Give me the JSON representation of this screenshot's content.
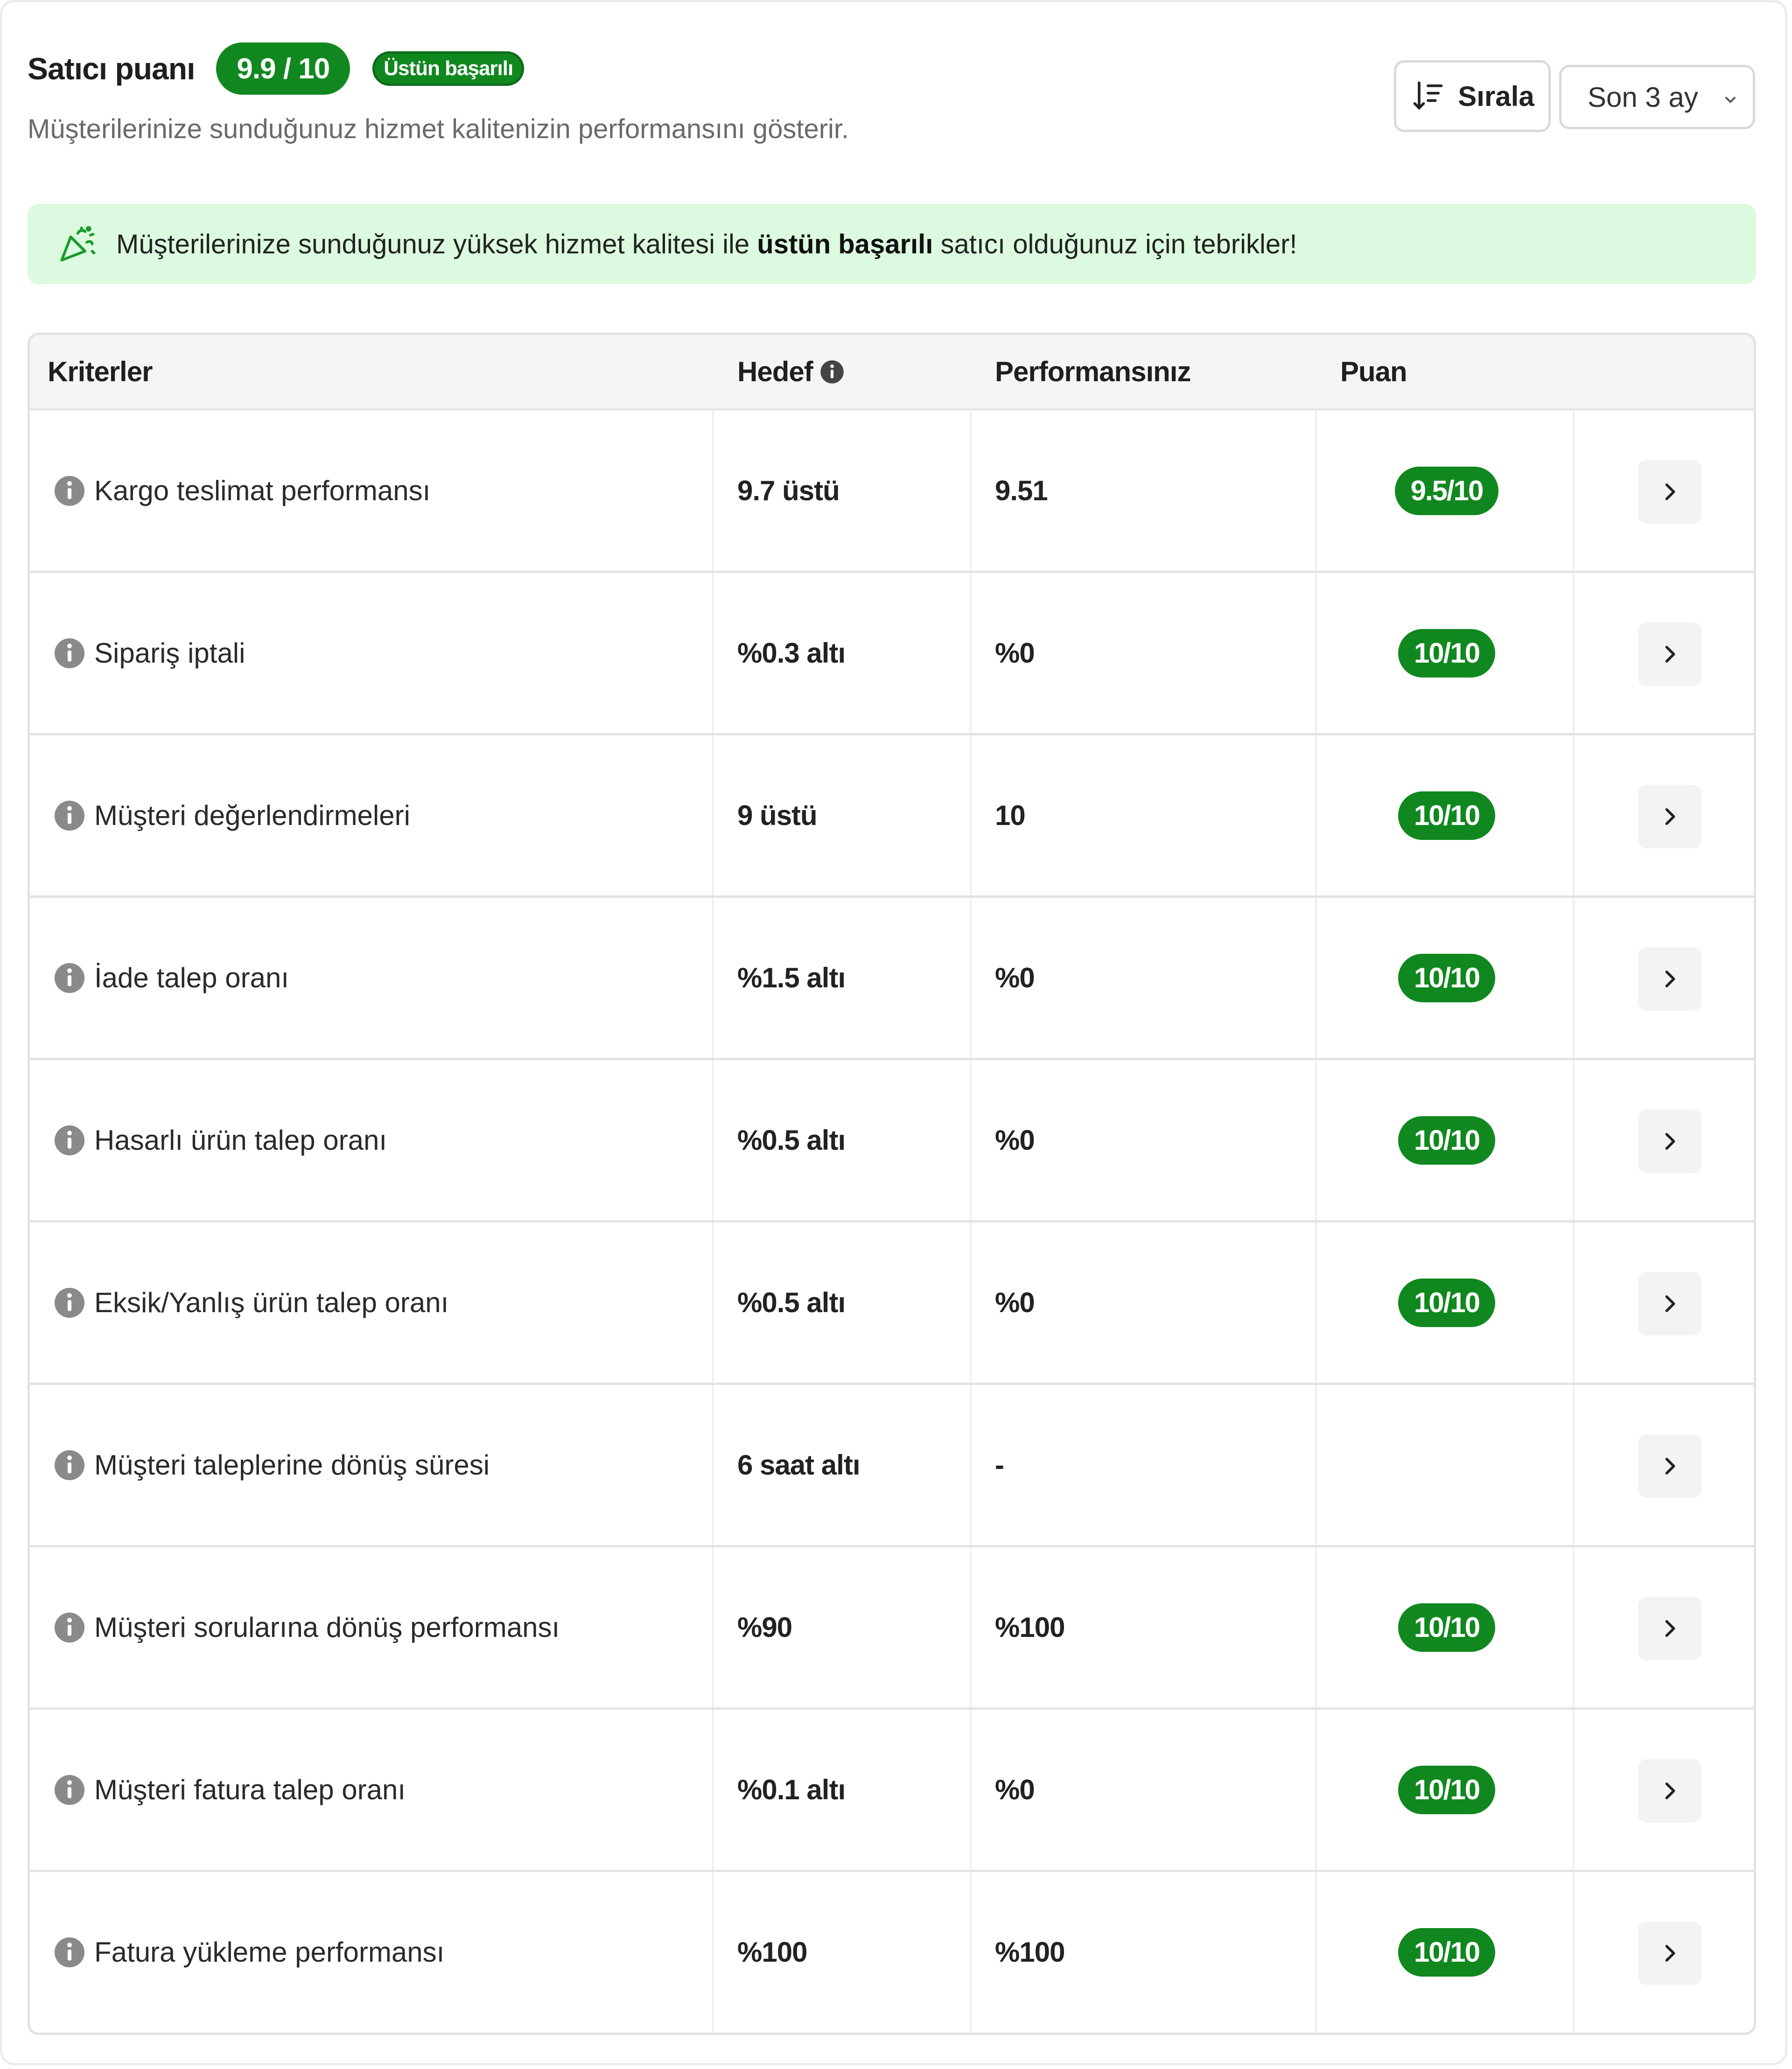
{
  "header": {
    "title": "Satıcı puanı",
    "score": "9.9 / 10",
    "badge": "Üstün başarılı",
    "subtitle": "Müşterilerinize sunduğunuz hizmet kalitenizin performansını gösterir.",
    "sort_label": "Sırala",
    "period_value": "Son 3 ay"
  },
  "banner": {
    "text_before": "Müşterilerinize sunduğunuz yüksek hizmet kalitesi ile ",
    "text_bold": "üstün başarılı",
    "text_after": " satıcı olduğunuz için tebrikler!"
  },
  "table": {
    "headers": {
      "criteria": "Kriterler",
      "target": "Hedef",
      "performance": "Performansınız",
      "score": "Puan"
    },
    "rows": [
      {
        "criteria": "Kargo teslimat performansı",
        "target": "9.7 üstü",
        "performance": "9.51",
        "score": "9.5/10"
      },
      {
        "criteria": "Sipariş iptali",
        "target": "%0.3 altı",
        "performance": "%0",
        "score": "10/10"
      },
      {
        "criteria": "Müşteri değerlendirmeleri",
        "target": "9 üstü",
        "performance": "10",
        "score": "10/10"
      },
      {
        "criteria": "İade talep oranı",
        "target": "%1.5 altı",
        "performance": "%0",
        "score": "10/10"
      },
      {
        "criteria": "Hasarlı ürün talep oranı",
        "target": "%0.5 altı",
        "performance": "%0",
        "score": "10/10"
      },
      {
        "criteria": "Eksik/Yanlış ürün talep oranı",
        "target": "%0.5 altı",
        "performance": "%0",
        "score": "10/10"
      },
      {
        "criteria": "Müşteri taleplerine dönüş süresi",
        "target": "6 saat altı",
        "performance": "-",
        "score": ""
      },
      {
        "criteria": "Müşteri sorularına dönüş performansı",
        "target": "%90",
        "performance": "%100",
        "score": "10/10"
      },
      {
        "criteria": "Müşteri fatura talep oranı",
        "target": "%0.1 altı",
        "performance": "%0",
        "score": "10/10"
      },
      {
        "criteria": "Fatura yükleme performansı",
        "target": "%100",
        "performance": "%100",
        "score": "10/10"
      }
    ]
  },
  "icons": {
    "info": "info-icon",
    "chevron": "chevron-right-icon",
    "sort": "sort-icon",
    "celebration": "party-popper-icon"
  },
  "colors": {
    "accent_green": "#11881f",
    "banner_bg": "#dcfadf"
  }
}
